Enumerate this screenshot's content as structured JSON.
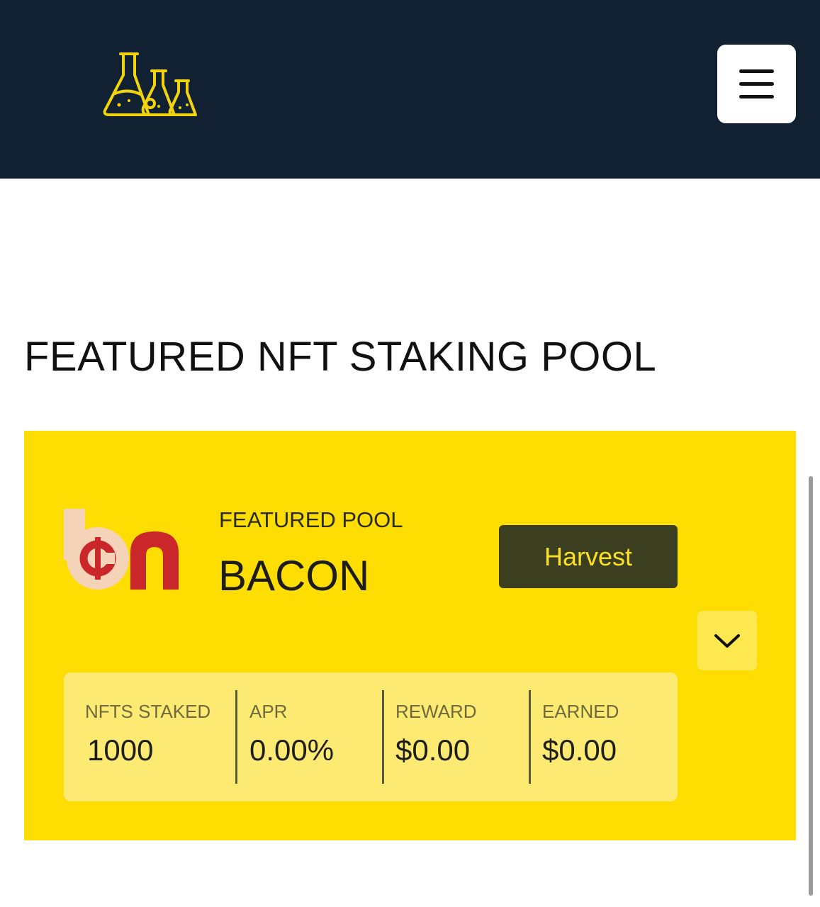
{
  "header": {
    "logo_icon": "flasks-icon",
    "menu_icon": "hamburger-menu-icon"
  },
  "page": {
    "title": "FEATURED NFT STAKING POOL"
  },
  "pool": {
    "logo_icon": "bacon-token-logo",
    "featured_label": "FEATURED POOL",
    "name": "BACON",
    "harvest_label": "Harvest",
    "expand_icon": "chevron-down-icon",
    "stats": [
      {
        "label": "NFTS STAKED",
        "value": "1000"
      },
      {
        "label": "APR",
        "value": "0.00%"
      },
      {
        "label": "REWARD",
        "value": "$0.00"
      },
      {
        "label": "EARNED",
        "value": "$0.00"
      }
    ]
  },
  "colors": {
    "header_bg": "#122132",
    "accent_yellow": "#fddd02",
    "stats_bg": "#fdea72",
    "harvest_bg": "#3b3f20",
    "harvest_text": "#fde021",
    "logo_red": "#c9272a",
    "logo_peach": "#f5d3b8"
  }
}
